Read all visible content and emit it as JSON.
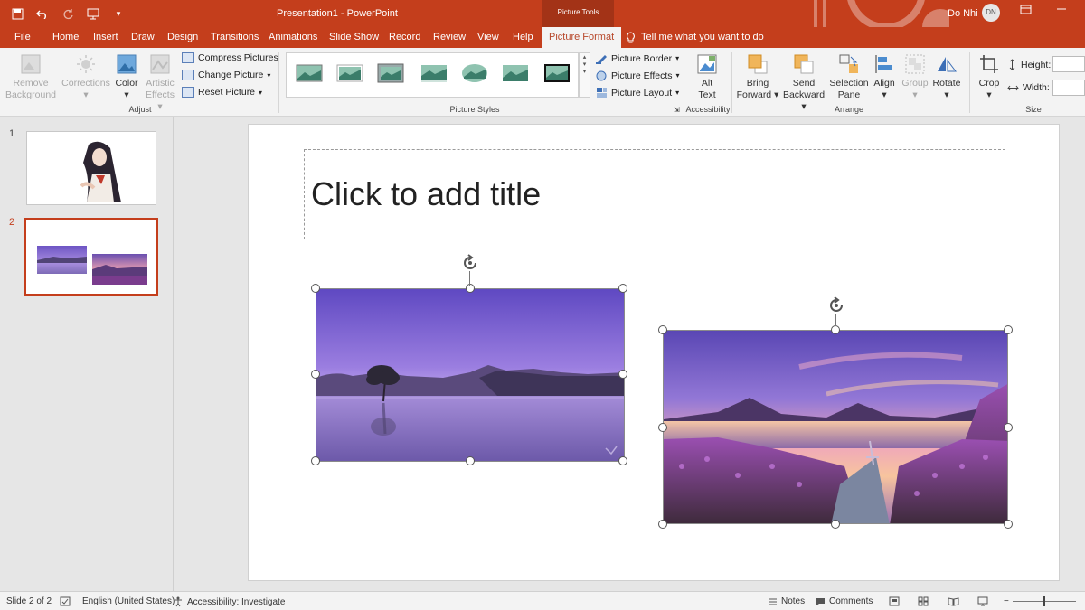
{
  "window": {
    "doc_title": "Presentation1 - PowerPoint",
    "contextual_group": "Picture Tools",
    "user_name": "Do Nhi",
    "user_initials": "DN"
  },
  "tabs": [
    "File",
    "Home",
    "Insert",
    "Draw",
    "Design",
    "Transitions",
    "Animations",
    "Slide Show",
    "Record",
    "Review",
    "View",
    "Help",
    "Picture Format"
  ],
  "active_tab": "Picture Format",
  "tell_me": "Tell me what you want to do",
  "ribbon": {
    "adjust": {
      "remove_background": [
        "Remove",
        "Background"
      ],
      "corrections": "Corrections",
      "color": "Color",
      "artistic_effects": [
        "Artistic",
        "Effects"
      ],
      "compress": "Compress Pictures",
      "change": "Change Picture",
      "reset": "Reset Picture",
      "label": "Adjust"
    },
    "styles": {
      "border": "Picture Border",
      "effects": "Picture Effects",
      "layout": "Picture Layout",
      "label": "Picture Styles"
    },
    "accessibility": {
      "alt_text": [
        "Alt",
        "Text"
      ],
      "label": "Accessibility"
    },
    "arrange": {
      "bring_forward": [
        "Bring",
        "Forward"
      ],
      "send_backward": [
        "Send",
        "Backward"
      ],
      "selection_pane": [
        "Selection",
        "Pane"
      ],
      "align": "Align",
      "group": "Group",
      "rotate": "Rotate",
      "label": "Arrange"
    },
    "size": {
      "crop": "Crop",
      "height_label": "Height:",
      "width_label": "Width:",
      "label": "Size"
    }
  },
  "slides": [
    {
      "number": "1"
    },
    {
      "number": "2"
    }
  ],
  "slide": {
    "title_placeholder": "Click to add title"
  },
  "status": {
    "slide_info": "Slide 2 of 2",
    "language": "English (United States)",
    "accessibility": "Accessibility: Investigate",
    "notes": "Notes",
    "comments": "Comments"
  },
  "colors": {
    "accent": "#c43e1c",
    "ribbon_bg": "#f3f3f3"
  }
}
